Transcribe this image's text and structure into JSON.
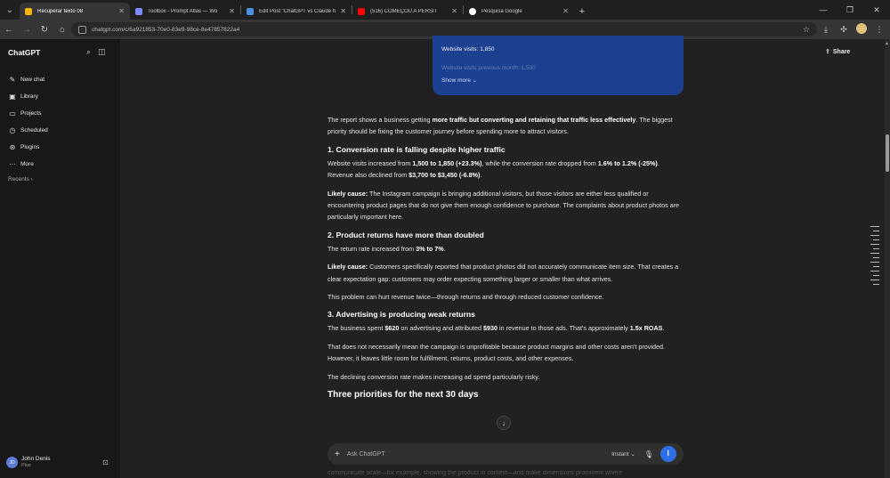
{
  "browser": {
    "tabs": [
      {
        "label": "Recuperar texto 08",
        "color": "#f4b400",
        "active": true
      },
      {
        "label": "Toolbox - Prompt Atlas — Wo",
        "color": "#7b8cff",
        "active": false
      },
      {
        "label": "Edit Post \"ChatGPT vs Claude h",
        "color": "#4a90e2",
        "active": false
      },
      {
        "label": "(516) COMEÇOU A PERSIT",
        "color": "#ff0000",
        "active": false
      },
      {
        "label": "Pesquisa Google",
        "color": "#ffffff",
        "active": false
      }
    ],
    "url": "chatgpt.com/c/6a921853-70e0-83e9-98ce-8e47857822a4",
    "icons": {
      "back": "back-arrow-icon",
      "forward": "forward-arrow-icon",
      "reload": "reload-icon",
      "home": "home-icon",
      "star": "star-icon",
      "download": "download-icon",
      "extensions": "puzzle-icon",
      "menu": "kebab-icon"
    }
  },
  "sidebar": {
    "brand": "ChatGPT",
    "items": [
      {
        "label": "New chat",
        "icon": "✎"
      },
      {
        "label": "Library",
        "icon": "▣"
      },
      {
        "label": "Projects",
        "icon": "▭"
      },
      {
        "label": "Scheduled",
        "icon": "◷"
      },
      {
        "label": "Plugins",
        "icon": "⊛"
      },
      {
        "label": "More",
        "icon": "···"
      }
    ],
    "recents": "Recents ›",
    "user": {
      "initials": "JD",
      "name": "John Denis",
      "plan": "Plus"
    }
  },
  "header": {
    "share": "Share"
  },
  "card": {
    "line1": "Website visits: 1,850",
    "line2": "Website visits previous month: 1,500",
    "show_more": "Show more ⌄"
  },
  "content": {
    "intro_a": "The report shows a business getting ",
    "intro_b": "more traffic but converting and retaining that traffic less effectively",
    "intro_c": ". The biggest priority should be fixing the customer journey before spending more to attract visitors.",
    "h1": "1. Conversion rate is falling despite higher traffic",
    "p1a": "Website visits increased from ",
    "p1b": "1,500 to 1,850 (+23.3%)",
    "p1c": ", while the conversion rate dropped from ",
    "p1d": "1.6% to 1.2% (-25%)",
    "p1e": ". Revenue also declined from ",
    "p1f": "$3,700 to $3,450 (-6.8%)",
    "p1g": ".",
    "p2a": "Likely cause:",
    "p2b": " The Instagram campaign is bringing additional visitors, but those visitors are either less qualified or encountering product pages that do not give them enough confidence to purchase. The complaints about product photos are particularly important here.",
    "h2": "2. Product returns have more than doubled",
    "p3a": "The return rate increased from ",
    "p3b": "3% to 7%",
    "p3c": ".",
    "p4a": "Likely cause:",
    "p4b": " Customers specifically reported that product photos did not accurately communicate item size. That creates a clear expectation gap: customers may order expecting something larger or smaller than what arrives.",
    "p5": "This problem can hurt revenue twice—through returns and through reduced customer confidence.",
    "h3": "3. Advertising is producing weak returns",
    "p6a": "The business spent ",
    "p6b": "$620",
    "p6c": " on advertising and attributed ",
    "p6d": "$930",
    "p6e": " in revenue to those ads. That's approximately ",
    "p6f": "1.5x ROAS",
    "p6g": ".",
    "p7": "That does not necessarily mean the campaign is unprofitable because product margins and other costs aren't provided. However, it leaves little room for fulfillment, returns, product costs, and other expenses.",
    "p8": "The declining conversion rate makes increasing ad spend particularly risky.",
    "h4": "Three priorities for the next 30 days"
  },
  "composer": {
    "placeholder": "Ask ChatGPT",
    "mode": "Instant ⌄",
    "below": "communicate scale—for example, showing the product in context—and make dimensions prominent where"
  }
}
